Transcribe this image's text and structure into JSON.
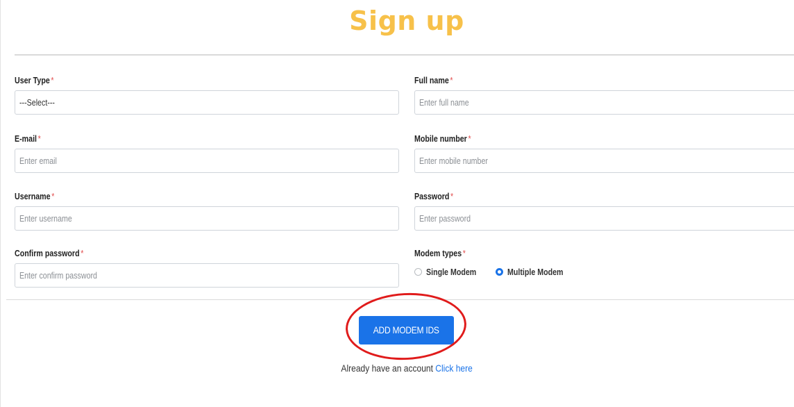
{
  "page": {
    "title": "Sign up"
  },
  "form": {
    "user_type": {
      "label": "User Type",
      "required": "*",
      "value": "---Select---"
    },
    "full_name": {
      "label": "Full name",
      "required": "*",
      "placeholder": "Enter full name"
    },
    "email": {
      "label": "E-mail",
      "required": "*",
      "placeholder": "Enter email"
    },
    "mobile": {
      "label": "Mobile number",
      "required": "*",
      "placeholder": "Enter mobile number"
    },
    "username": {
      "label": "Username",
      "required": "*",
      "placeholder": "Enter username"
    },
    "password": {
      "label": "Password",
      "required": "*",
      "placeholder": "Enter password"
    },
    "confirm_password": {
      "label": "Confirm password",
      "required": "*",
      "placeholder": "Enter confirm password"
    },
    "modem_types": {
      "label": "Modem types",
      "required": "*",
      "options": [
        {
          "label": "Single Modem",
          "selected": false
        },
        {
          "label": "Multiple Modem",
          "selected": true
        }
      ]
    }
  },
  "actions": {
    "add_modem_ids_label": "ADD MODEM IDS"
  },
  "footer": {
    "prompt": "Already have an account",
    "link": "Click here"
  },
  "colors": {
    "title": "#f7c14a",
    "accent": "#1a73e8",
    "required": "#e24b4b",
    "annotation_circle": "#e01b1b"
  }
}
